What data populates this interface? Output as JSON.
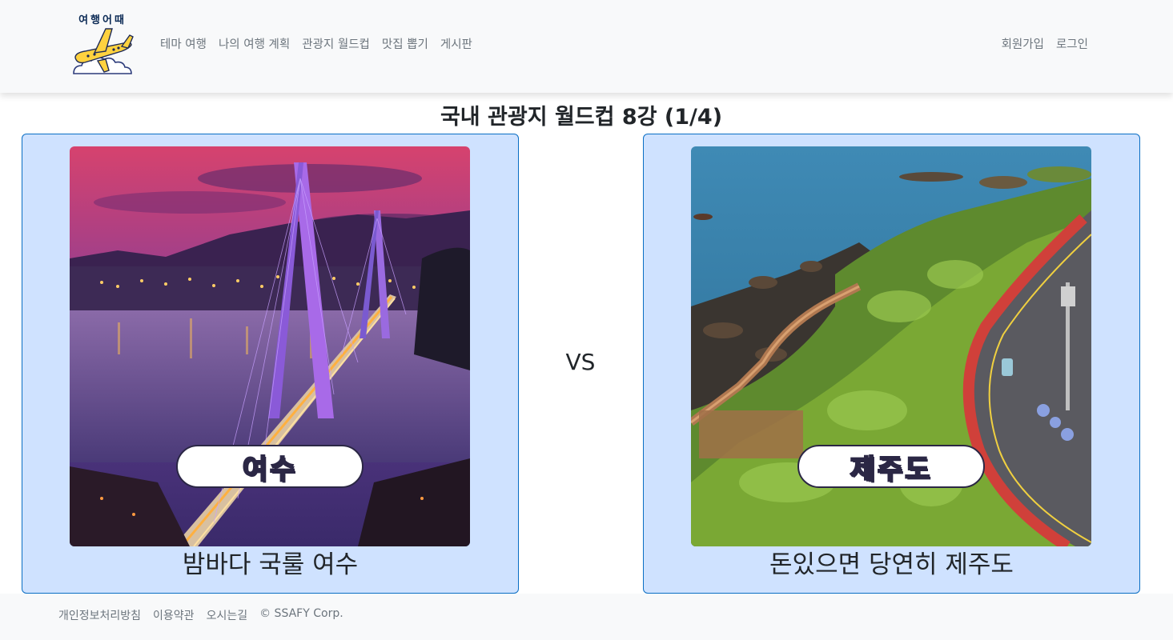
{
  "header": {
    "logo_text": "여행어때",
    "nav": [
      {
        "label": "테마 여행"
      },
      {
        "label": "나의 여행 계획"
      },
      {
        "label": "관광지 월드컵"
      },
      {
        "label": "맛집 뽑기"
      },
      {
        "label": "게시판"
      }
    ],
    "signup_label": "회원가입",
    "login_label": "로그인"
  },
  "page": {
    "title": "국내 관광지 월드컵 8강 (1/4)",
    "vs_label": "VS"
  },
  "candidates": [
    {
      "name": "여수",
      "caption": "밤바다 국룰 여수",
      "image": "yeosu-night-bridge-photo"
    },
    {
      "name": "제주도",
      "caption": "돈있으면 당연히 제주도",
      "image": "jeju-coastal-road-photo"
    }
  ],
  "footer": {
    "links": [
      {
        "label": "개인정보처리방침"
      },
      {
        "label": "이용약관"
      },
      {
        "label": "오시는길"
      }
    ],
    "copyright": "© SSAFY Corp."
  },
  "colors": {
    "card_bg": "#cfe2ff",
    "card_border": "#0a6ec4",
    "name_fill": "#d6f56e",
    "name_outline": "#2b2745",
    "nav_text": "#6c757d"
  }
}
